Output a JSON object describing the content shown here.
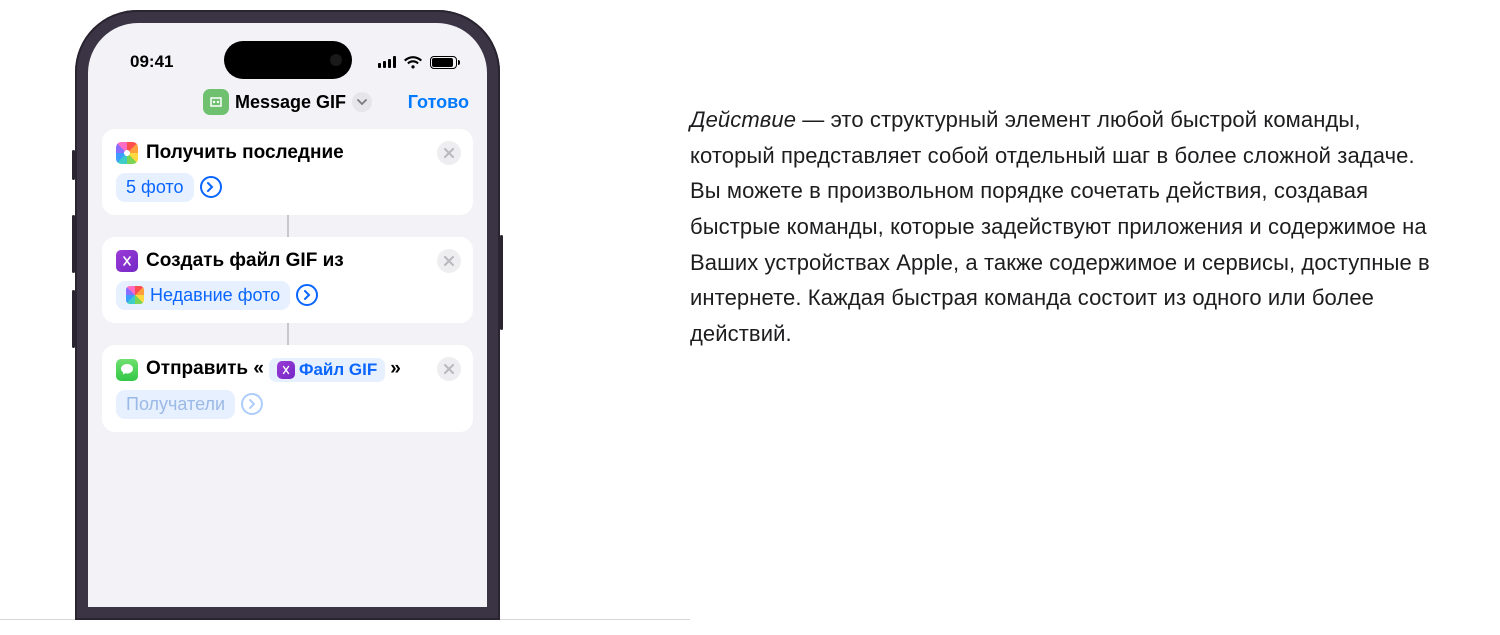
{
  "status": {
    "time": "09:41"
  },
  "nav": {
    "title": "Message GIF",
    "done": "Готово"
  },
  "actions": [
    {
      "title_prefix": "Получить последние",
      "param_pill": "5 фото"
    },
    {
      "title_prefix": "Создать файл GIF из",
      "param_pill": "Недавние фото"
    },
    {
      "title_prefix": "Отправить «",
      "inline_token": "Файл GIF",
      "title_suffix": "»",
      "param_pill": "Получатели"
    }
  ],
  "article": {
    "emphasis": "Действие",
    "body": " — это структурный элемент любой быстрой команды, который представляет собой отдельный шаг в более сложной задаче. Вы можете в произвольном порядке сочетать действия, создавая быстрые команды, которые задействуют приложения и содержимое на Ваших устройствах Apple, а также содержимое и сервисы, доступные в интернете. Каждая быстрая команда состоит из одного или более действий."
  }
}
